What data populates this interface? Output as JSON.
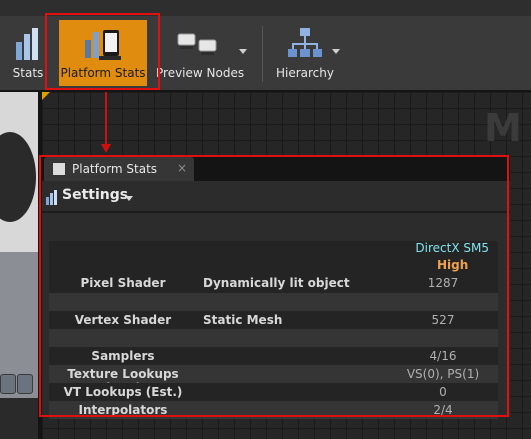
{
  "toolbar": {
    "buttons": [
      {
        "label": "Stats",
        "icon": "stats-icon"
      },
      {
        "label": "Platform Stats",
        "icon": "platform-stats-icon"
      },
      {
        "label": "Preview Nodes",
        "icon": "preview-nodes-icon"
      },
      {
        "label": "Hierarchy",
        "icon": "hierarchy-icon"
      }
    ]
  },
  "viewport": {
    "watermark": "M"
  },
  "panel": {
    "tab": {
      "label": "Platform Stats",
      "close": "×"
    },
    "settings_label": "Settings",
    "platform": "DirectX SM5",
    "quality": "High",
    "rows": [
      {
        "name": "",
        "desc": "",
        "value": ""
      },
      {
        "name": "Pixel Shader",
        "desc": "Dynamically lit object",
        "value": "1287"
      },
      {
        "name": "",
        "desc": "",
        "value": ""
      },
      {
        "name": "Vertex Shader",
        "desc": "Static Mesh",
        "value": "527"
      },
      {
        "name": "",
        "desc": "",
        "value": ""
      },
      {
        "name": "Samplers",
        "desc": "",
        "value": "4/16"
      },
      {
        "name": "Texture Lookups (Est.)",
        "desc": "",
        "value": "VS(0), PS(1)"
      },
      {
        "name": "VT Lookups (Est.)",
        "desc": "",
        "value": "0"
      },
      {
        "name": "Interpolators",
        "desc": "",
        "value": "2/4"
      }
    ]
  },
  "colors": {
    "accent": "#e08c0f",
    "highlight_box": "#e01010",
    "platform_text": "#7fe3ef",
    "quality_text": "#f0a24c"
  }
}
